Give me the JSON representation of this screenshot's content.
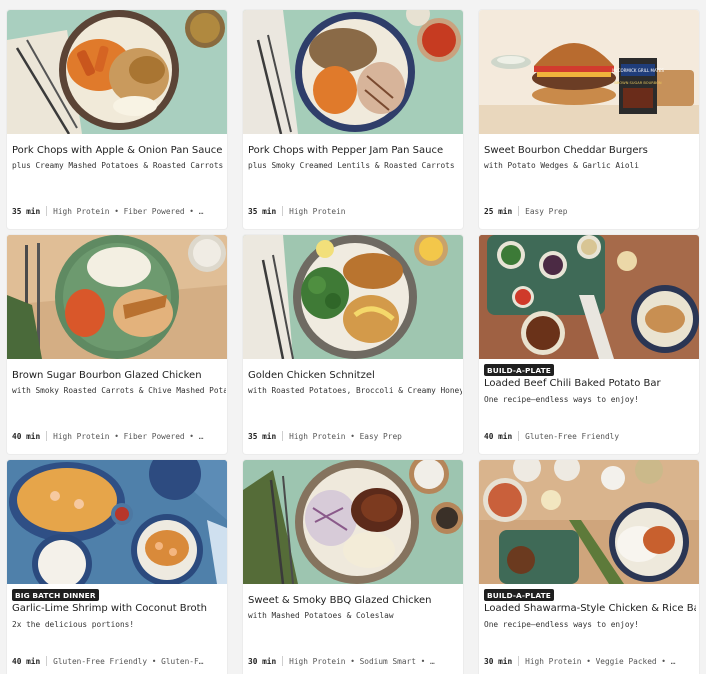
{
  "recipes": [
    {
      "title": "Pork Chops with Apple & Onion Pan Sauce",
      "subtitle": "plus Creamy Mashed Potatoes & Roasted Carrots",
      "time": "35 min",
      "tags": "High Protein • Fiber Powered • …",
      "badge": ""
    },
    {
      "title": "Pork Chops with Pepper Jam Pan Sauce",
      "subtitle": "plus Smoky Creamed Lentils & Roasted Carrots",
      "time": "35 min",
      "tags": "High Protein",
      "badge": ""
    },
    {
      "title": "Sweet Bourbon Cheddar Burgers",
      "subtitle": "with Potato Wedges & Garlic Aioli",
      "time": "25 min",
      "tags": "Easy Prep",
      "badge": ""
    },
    {
      "title": "Brown Sugar Bourbon Glazed Chicken",
      "subtitle": "with Smoky Roasted Carrots & Chive Mashed Potatoes",
      "time": "40 min",
      "tags": "High Protein • Fiber Powered • …",
      "badge": ""
    },
    {
      "title": "Golden Chicken Schnitzel",
      "subtitle": "with Roasted Potatoes, Broccoli & Creamy Honey Di…",
      "time": "35 min",
      "tags": "High Protein • Easy Prep",
      "badge": ""
    },
    {
      "title": "Loaded Beef Chili Baked Potato Bar",
      "subtitle": "One recipe—endless ways to enjoy!",
      "time": "40 min",
      "tags": "Gluten-Free Friendly",
      "badge": "BUILD-A-PLATE"
    },
    {
      "title": "Garlic-Lime Shrimp with Coconut Broth",
      "subtitle": "2x the delicious portions!",
      "time": "40 min",
      "tags": "Gluten-Free Friendly • Gluten-F…",
      "badge": "BIG BATCH DINNER"
    },
    {
      "title": "Sweet & Smoky BBQ Glazed Chicken",
      "subtitle": "with Mashed Potatoes & Coleslaw",
      "time": "30 min",
      "tags": "High Protein • Sodium Smart • …",
      "badge": ""
    },
    {
      "title": "Loaded Shawarma-Style Chicken & Rice Bar",
      "subtitle": "One recipe—endless ways to enjoy!",
      "time": "30 min",
      "tags": "High Protein • Veggie Packed • …",
      "badge": "BUILD-A-PLATE"
    }
  ],
  "product_package": {
    "brand": "McCORMICK GRILL MATES",
    "name": "BROWN SUGAR BOURBON"
  },
  "colors": {
    "page_bg": "#f3f3f3",
    "card_bg": "#ffffff",
    "badge_bg": "#1f1f1f",
    "photo_green": "#9cc6b1",
    "photo_wood": "#d9b58e",
    "photo_blue": "#4d7fa9"
  }
}
